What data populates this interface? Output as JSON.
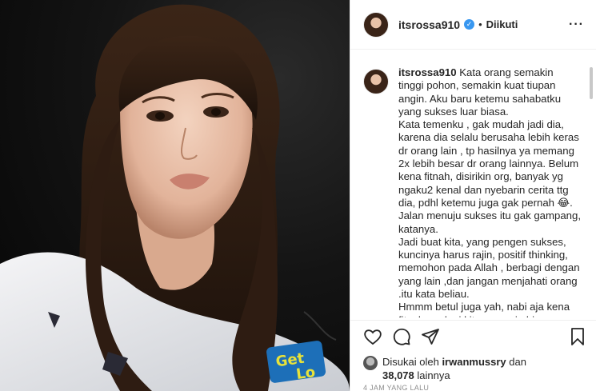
{
  "post": {
    "username": "itsrossa910",
    "verified_glyph": "✓",
    "separator": "•",
    "follow_state": "Diikuti",
    "more_glyph": "···"
  },
  "photo": {
    "sweater_text_1": "Get",
    "sweater_text_2": "Lo"
  },
  "caption": {
    "username": "itsrossa910",
    "body": " Kata orang semakin tinggi pohon, semakin kuat tiupan angin. Aku baru ketemu sahabatku yang sukses luar biasa.\nKata temenku , gak mudah jadi dia, karena dia selalu berusaha lebih keras dr orang lain , tp hasilnya ya memang 2x lebih besar dr orang lainnya. Belum kena fitnah, disirikin org, banyak yg ngaku2 kenal dan nyebarin cerita ttg dia, pdhl ketemu juga gak pernah 😂. Jalan menuju sukses itu gak gampang, katanya.\nJadi buat kita, yang pengen sukses, kuncinya harus rajin, positif thinking, memohon pada Allah , berbagi dengan yang lain ,dan jangan menjahati orang .itu kata beliau.\nHmmm betul juga yah, nabi aja kena fitnah apalagi kita manusia biasa"
  },
  "actions": {
    "like_icon": "heart-icon",
    "comment_icon": "comment-icon",
    "share_icon": "share-icon",
    "save_icon": "bookmark-icon"
  },
  "likes": {
    "prefix": "Disukai oleh ",
    "user": "irwanmussry",
    "middle": " dan",
    "count": "38,078",
    "suffix": " lainnya"
  },
  "timestamp": "4 JAM YANG LALU"
}
